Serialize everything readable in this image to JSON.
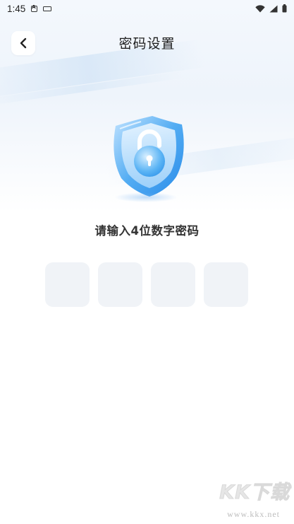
{
  "status_bar": {
    "time": "1:45",
    "icons": [
      "a-badge-icon",
      "keyboard-icon",
      "wifi-icon",
      "signal-icon",
      "battery-icon"
    ]
  },
  "header": {
    "title": "密码设置",
    "back_icon": "chevron-left-icon"
  },
  "hero": {
    "icon": "shield-lock-icon",
    "accent_color": "#3a9bf0"
  },
  "prompt": "请输入4位数字密码",
  "pin": {
    "length": 4,
    "box_color": "#f0f3f7"
  },
  "watermark": {
    "logo_text": "KK下载",
    "url": "www.kkx.net"
  }
}
